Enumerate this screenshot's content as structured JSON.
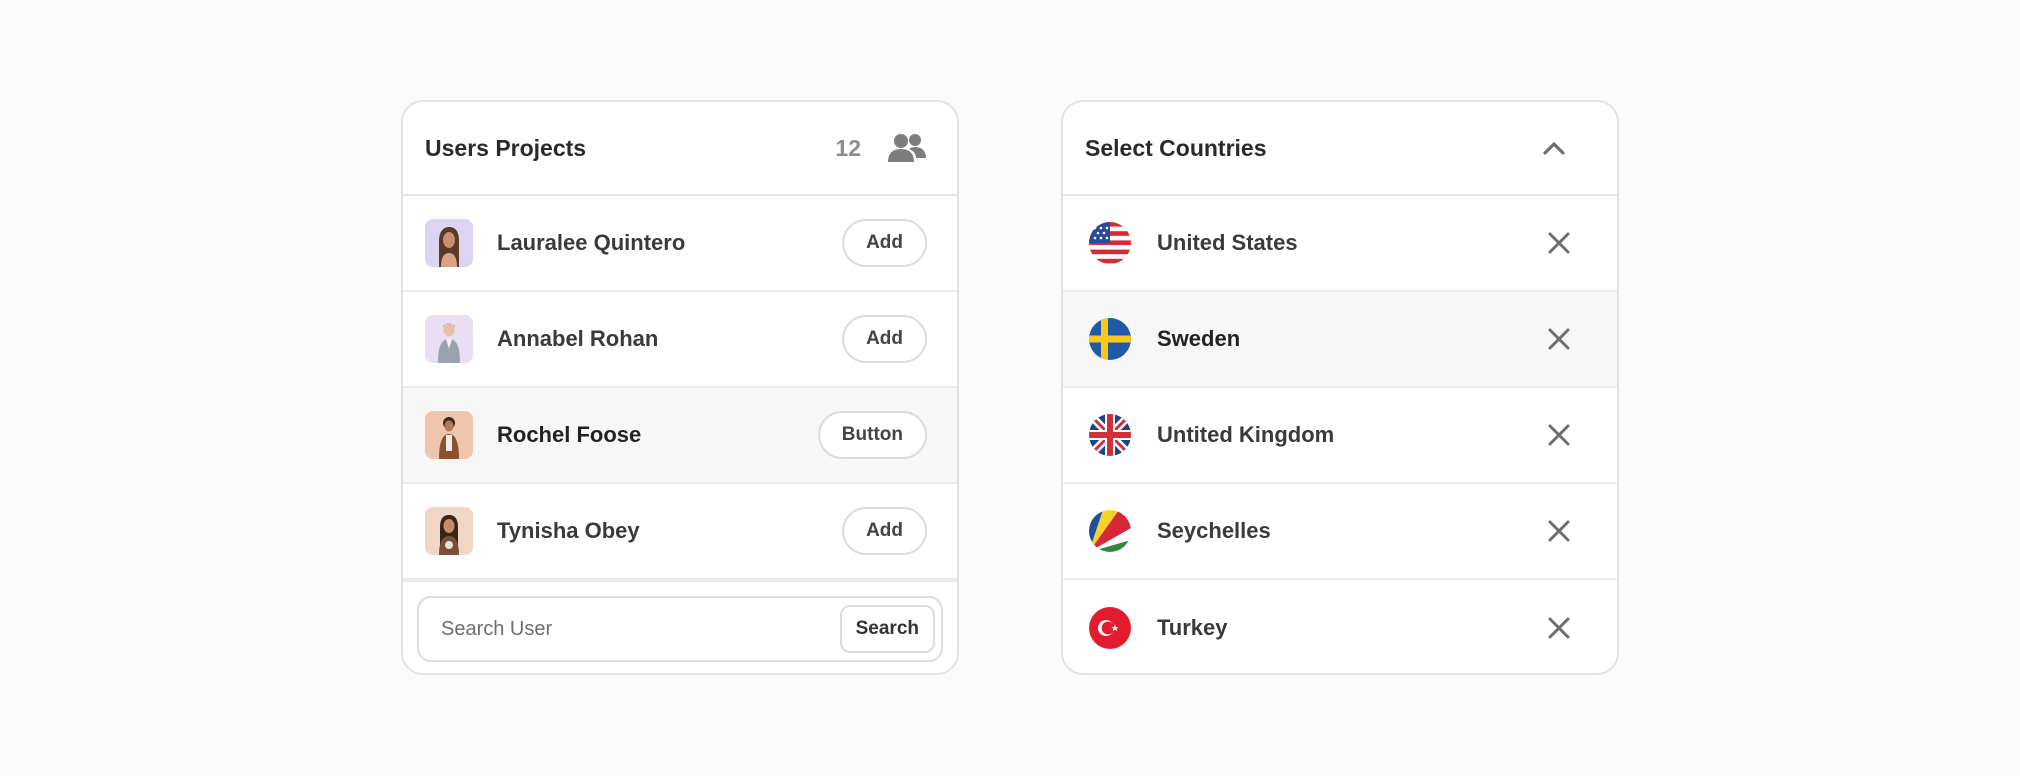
{
  "users_card": {
    "title": "Users Projects",
    "count": "12",
    "users": [
      {
        "name": "Lauralee Quintero",
        "action": "Add",
        "avatar_bg": "#ddd3f2"
      },
      {
        "name": "Annabel Rohan",
        "action": "Add",
        "avatar_bg": "#e9def2"
      },
      {
        "name": "Rochel Foose",
        "action": "Button",
        "avatar_bg": "#efc6ad"
      },
      {
        "name": "Tynisha Obey",
        "action": "Add",
        "avatar_bg": "#f1d6c6"
      }
    ],
    "search": {
      "placeholder": "Search User",
      "button_label": "Search"
    }
  },
  "countries_card": {
    "title": "Select Countries",
    "countries": [
      {
        "name": "United States",
        "flag": "us-flag-icon"
      },
      {
        "name": "Sweden",
        "flag": "sweden-flag-icon"
      },
      {
        "name": "Untited Kingdom",
        "flag": "uk-flag-icon"
      },
      {
        "name": "Seychelles",
        "flag": "seychelles-flag-icon"
      },
      {
        "name": "Turkey",
        "flag": "turkey-flag-icon"
      }
    ]
  },
  "icons": {
    "people": "people-icon",
    "chevron": "chevron-up-icon",
    "close": "close-icon"
  }
}
